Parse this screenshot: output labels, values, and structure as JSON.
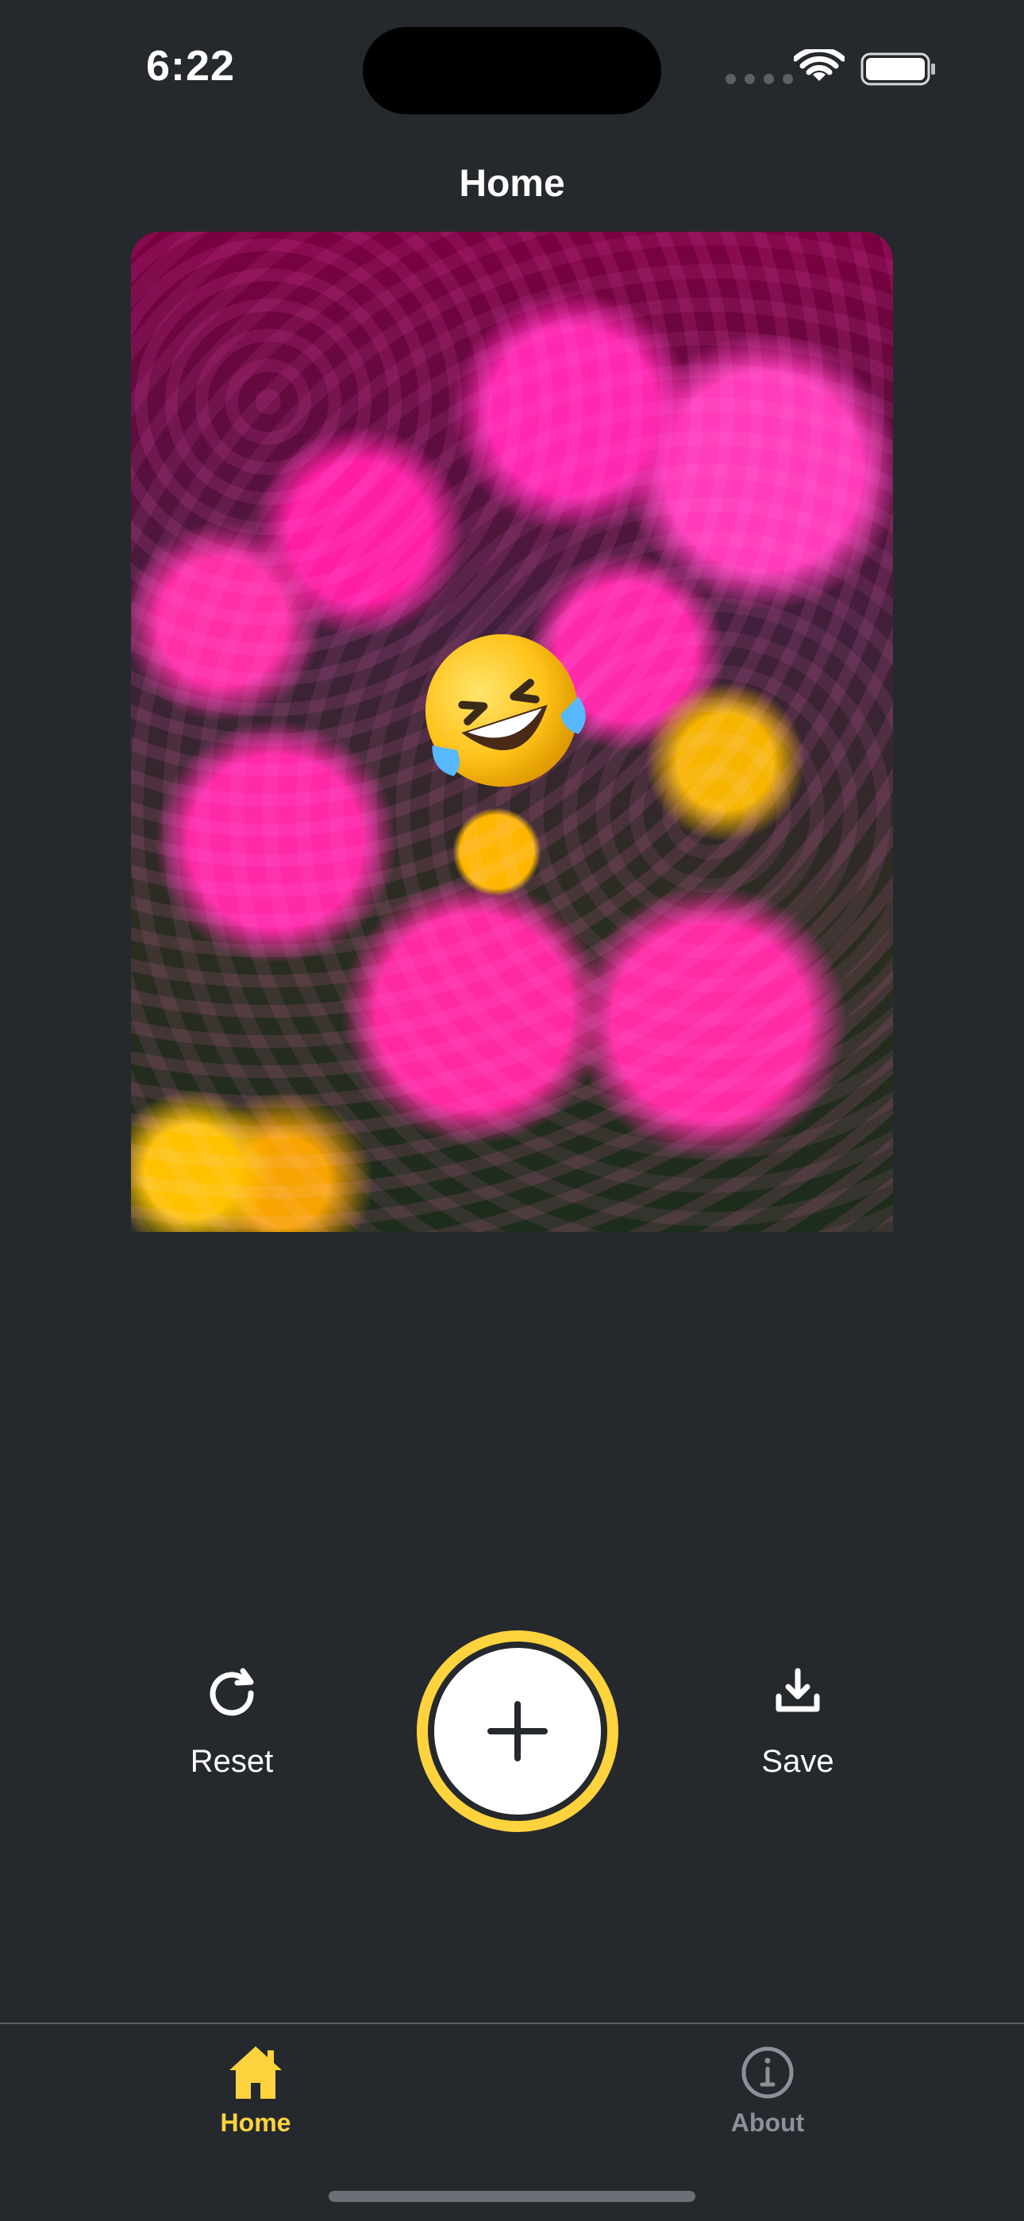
{
  "status_bar": {
    "time": "6:22"
  },
  "header": {
    "title": "Home"
  },
  "sticker": {
    "emoji": "🤣"
  },
  "controls": {
    "reset_label": "Reset",
    "save_label": "Save",
    "add_icon": "plus-icon"
  },
  "tabs": [
    {
      "label": "Home",
      "icon": "home-icon",
      "active": true
    },
    {
      "label": "About",
      "icon": "info-icon",
      "active": false
    }
  ],
  "colors": {
    "background": "#25292e",
    "accent": "#ffd33d",
    "inactive_tab": "#8b9199",
    "text": "#ffffff"
  }
}
